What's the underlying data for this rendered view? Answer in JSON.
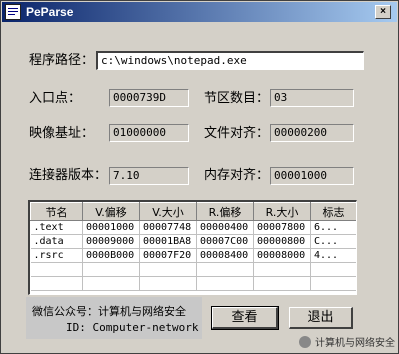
{
  "window": {
    "title": "PeParse",
    "close_glyph": "×"
  },
  "fields": {
    "path_label": "程序路径：",
    "path_value": "c:\\windows\\notepad.exe",
    "entry_label": "入口点：",
    "entry_value": "0000739D",
    "section_count_label": "节区数目：",
    "section_count_value": "03",
    "image_base_label": "映像基址：",
    "image_base_value": "01000000",
    "file_align_label": "文件对齐：",
    "file_align_value": "00000200",
    "linker_label": "连接器版本：",
    "linker_value": "7.10",
    "mem_align_label": "内存对齐：",
    "mem_align_value": "00001000"
  },
  "table": {
    "headers": [
      "节名",
      "V.偏移",
      "V.大小",
      "R.偏移",
      "R.大小",
      "标志"
    ],
    "rows": [
      [
        ".text",
        "00001000",
        "00007748",
        "00000400",
        "00007800",
        "6..."
      ],
      [
        ".data",
        "00009000",
        "00001BA8",
        "00007C00",
        "00000800",
        "C..."
      ],
      [
        ".rsrc",
        "0000B000",
        "00007F20",
        "00008400",
        "00008000",
        "4..."
      ]
    ]
  },
  "watermark": {
    "line1": "微信公众号：计算机与网络安全",
    "line2": "ID: Computer-network"
  },
  "buttons": {
    "view": "查看",
    "exit": "退出"
  },
  "credit": {
    "text": "计算机与网络安全"
  }
}
